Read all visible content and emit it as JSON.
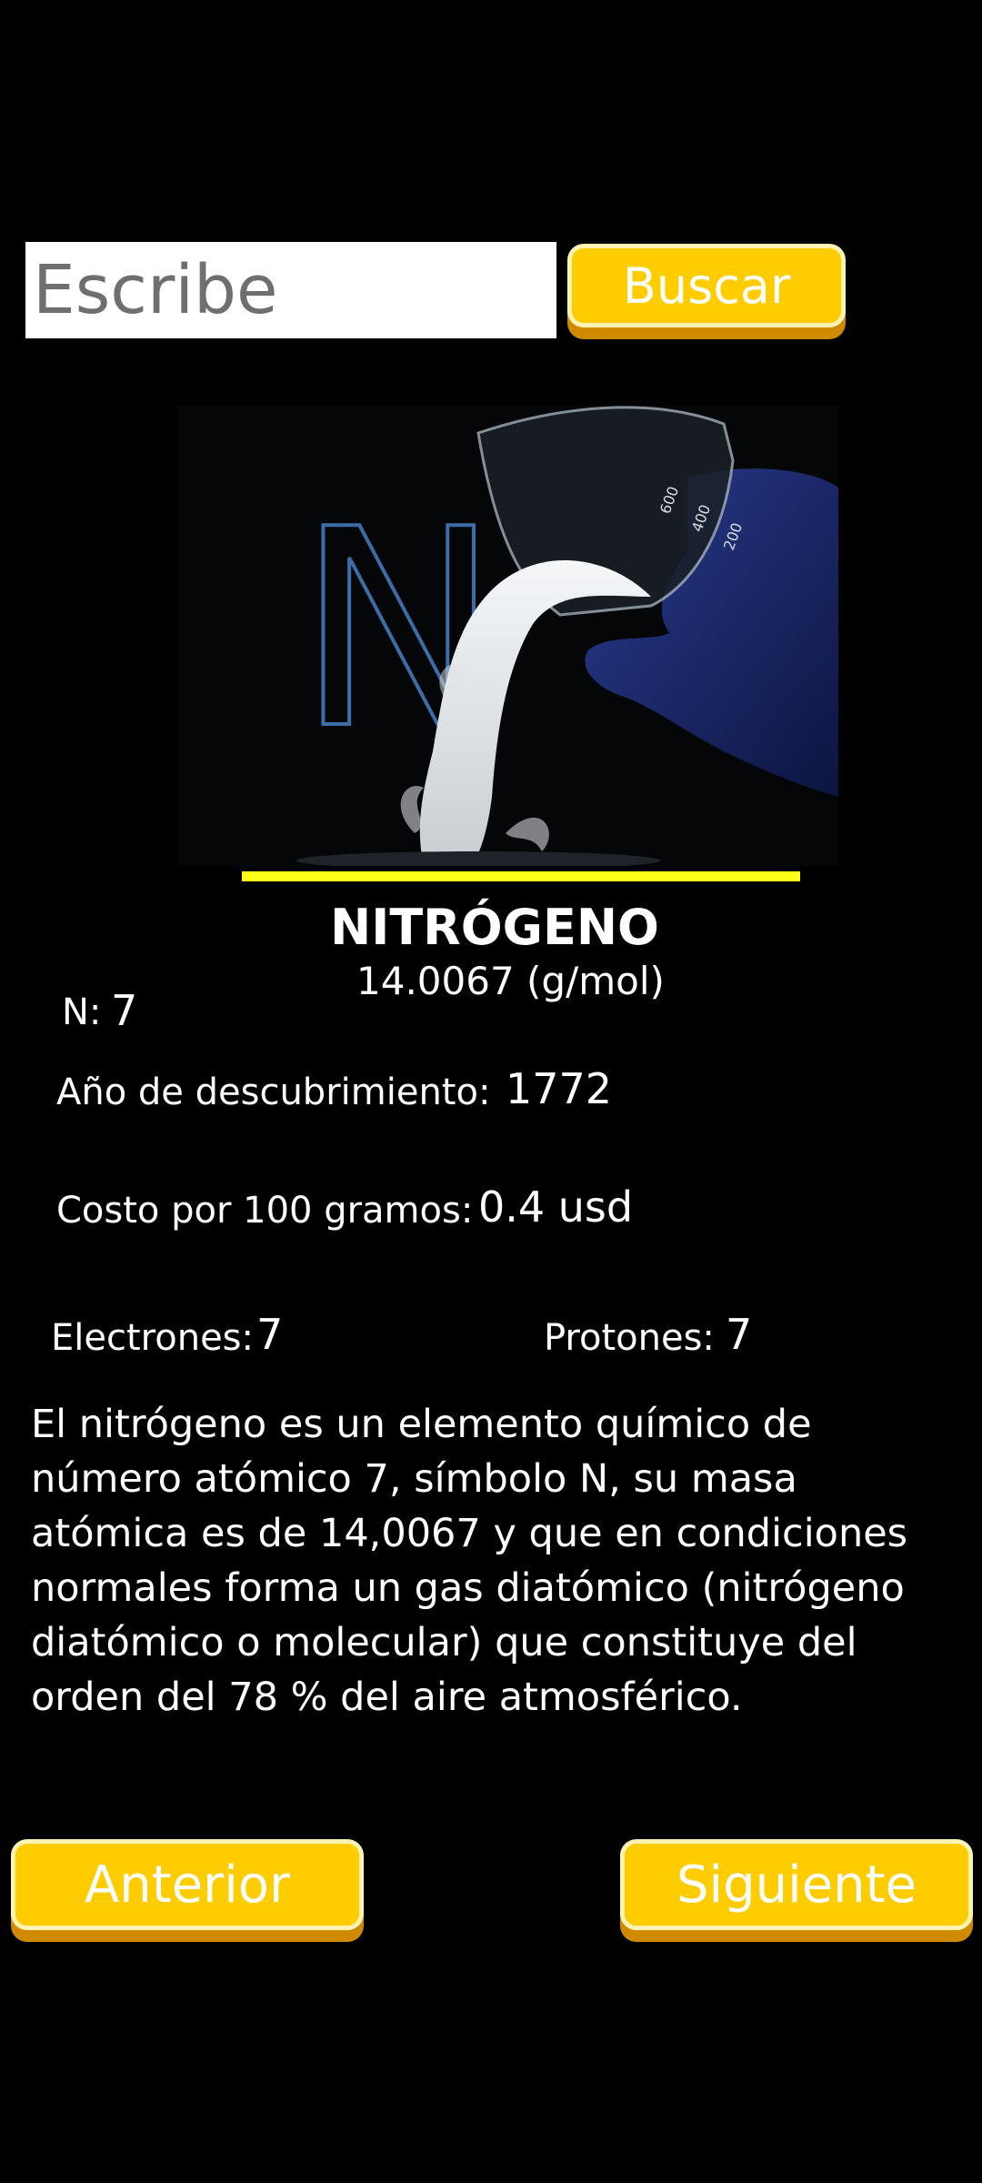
{
  "search": {
    "placeholder": "Escribe",
    "value": "",
    "button_label": "Buscar"
  },
  "element": {
    "image_icon": "nitrogen-pour-image",
    "symbol_in_image": "N",
    "image_beaker_marks": [
      "600",
      "400",
      "200"
    ],
    "name": "NITRÓGENO",
    "molar_mass": "14.0067 (g/mol)",
    "number_label": "N:",
    "number_value": "7",
    "discovery_label": "Año de descubrimiento:",
    "discovery_value": "1772",
    "cost_label": "Costo por 100 gramos:",
    "cost_value": "0.4 usd",
    "electrons_label": "Electrones:",
    "electrons_value": "7",
    "protons_label": "Protones:",
    "protons_value": "7",
    "description": "El nitrógeno es un elemento químico de número atómico 7, símbolo N, su masa atómica es de 14,0067 y que en condiciones normales forma un gas diatómico (nitrógeno diatómico o molecular) que constituye del orden del 78 % del aire atmosférico."
  },
  "nav": {
    "prev_label": "Anterior",
    "next_label": "Siguiente"
  },
  "colors": {
    "background": "#000000",
    "button": "#ffcc00",
    "button_shadow": "#d08a00",
    "underline": "#ffff1a"
  }
}
